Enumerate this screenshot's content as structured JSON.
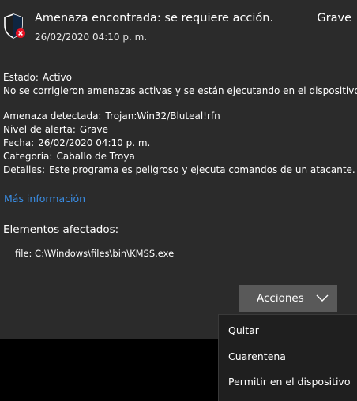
{
  "header": {
    "icon": "shield-alert-icon",
    "title": "Amenaza encontrada: se requiere acción.",
    "severity": "Grave",
    "date": "26/02/2020 04:10 p. m."
  },
  "status": {
    "label": "Estado:",
    "value": "Activo",
    "message": "No se corrigieron amenazas activas y se están ejecutando en el dispositivo."
  },
  "details": {
    "threat_label": "Amenaza detectada:",
    "threat_value": "Trojan:Win32/Bluteal!rfn",
    "alert_label": "Nivel de alerta:",
    "alert_value": "Grave",
    "date_label": "Fecha:",
    "date_value": "26/02/2020 04:10 p. m.",
    "category_label": "Categoría:",
    "category_value": "Caballo de Troya",
    "details_label": "Detalles:",
    "details_value": "Este programa es peligroso y ejecuta comandos de un atacante."
  },
  "more_info_link": "Más información",
  "affected": {
    "heading": "Elementos afectados:",
    "file": "file: C:\\Windows\\files\\bin\\KMSS.exe"
  },
  "actions": {
    "button_label": "Acciones",
    "menu": [
      "Quitar",
      "Cuarentena",
      "Permitir en el dispositivo"
    ]
  },
  "colors": {
    "panel_bg": "#2b2b2b",
    "link": "#3a8ee6",
    "button_bg": "#595959",
    "menu_bg": "#1f1f1f",
    "badge_red": "#e81123"
  }
}
